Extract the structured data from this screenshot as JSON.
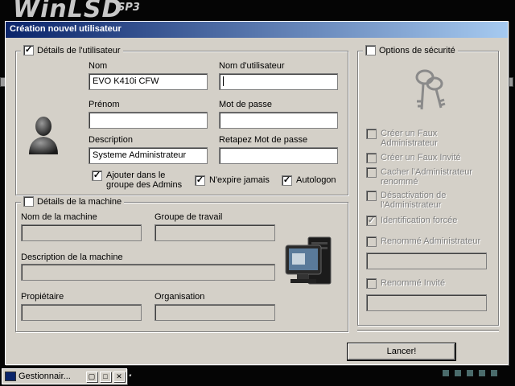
{
  "background": {
    "logo": "WinLSD",
    "logo_sup": "SP3"
  },
  "window": {
    "title": "Création nouvel utilisateur"
  },
  "user_details": {
    "legend": "Détails de l'utilisateur",
    "checked": true,
    "nom_label": "Nom",
    "nom_value": "EVO K410i CFW",
    "username_label": "Nom d'utilisateur",
    "username_value": "",
    "prenom_label": "Prénom",
    "prenom_value": "",
    "password_label": "Mot de passe",
    "password_value": "",
    "description_label": "Description",
    "description_value": "Systeme Administrateur",
    "retype_label": "Retapez Mot de passe",
    "retype_value": "",
    "admin_group_label_1": "Ajouter dans le",
    "admin_group_label_2": "groupe des Admins",
    "admin_group_checked": true,
    "never_expire_label": "N'expire jamais",
    "never_expire_checked": true,
    "autologon_label": "Autologon",
    "autologon_checked": true
  },
  "machine_details": {
    "legend": "Détails de la machine",
    "checked": false,
    "machine_name_label": "Nom de la machine",
    "workgroup_label": "Groupe de travail",
    "machine_desc_label": "Description de la machine",
    "owner_label": "Propiétaire",
    "organisation_label": "Organisation"
  },
  "security": {
    "legend": "Options de sécurité",
    "checked": false,
    "options": [
      {
        "line1": "Créer un Faux",
        "line2": "Administrateur",
        "checked": false
      },
      {
        "line1": "Créer un Faux Invité",
        "line2": "",
        "checked": false
      },
      {
        "line1": "Cacher l'Administrateur",
        "line2": "renommé",
        "checked": false
      },
      {
        "line1": "Désactivation de",
        "line2": "l'Administrateur",
        "checked": false
      },
      {
        "line1": "Identification forcée",
        "line2": "",
        "checked": true
      },
      {
        "line1": "Renommé Administrateur",
        "line2": "",
        "checked": false
      },
      {
        "line1": "Renommé Invité",
        "line2": "",
        "checked": false
      }
    ]
  },
  "launch_button": "Lancer!",
  "taskbar": {
    "item_label": "Gestionnair...",
    "restore_icon": "▢",
    "max_icon": "□",
    "close_icon": "✕"
  },
  "check_mark": "✓"
}
